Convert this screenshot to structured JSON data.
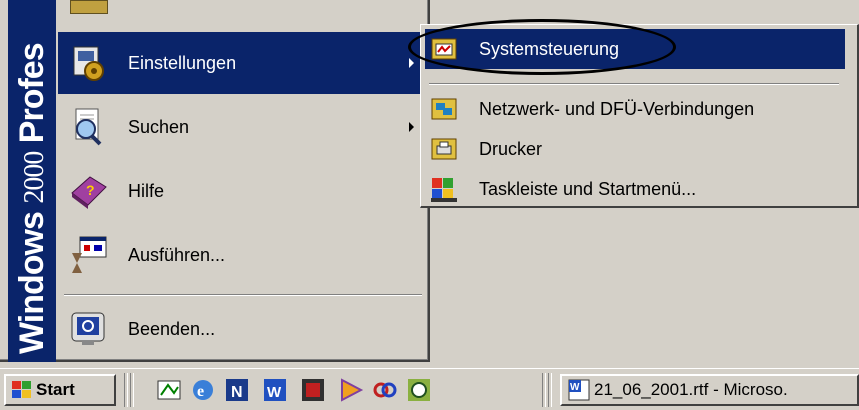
{
  "start_menu": {
    "banner_brand": "Windows",
    "banner_version": "2000",
    "banner_edition": "Profes",
    "items": [
      {
        "label": "Einstellungen",
        "icon": "settings-icon",
        "has_submenu": true,
        "selected": true
      },
      {
        "label": "Suchen",
        "icon": "search-icon",
        "has_submenu": true
      },
      {
        "label": "Hilfe",
        "icon": "help-book-icon",
        "has_submenu": false
      },
      {
        "label": "Ausführen...",
        "icon": "run-icon",
        "has_submenu": false
      },
      {
        "label": "Beenden...",
        "icon": "shutdown-icon",
        "has_submenu": false
      }
    ]
  },
  "submenu": {
    "items": [
      {
        "label": "Systemsteuerung",
        "icon": "control-panel-icon",
        "selected": true
      },
      {
        "label": "Netzwerk- und DFÜ-Verbindungen",
        "icon": "network-connections-icon"
      },
      {
        "label": "Drucker",
        "icon": "printers-icon"
      },
      {
        "label": "Taskleiste und Startmenü...",
        "icon": "taskbar-startmenu-icon"
      }
    ]
  },
  "taskbar": {
    "start_label": "Start",
    "quick_launch": [
      "show-desktop-icon",
      "internet-explorer-icon",
      "n-app-icon",
      "word-icon",
      "app-icon",
      "media-player-icon",
      "link-icon",
      "clock-app-icon"
    ],
    "task_button_label": "21_06_2001.rtf - Microso."
  },
  "colors": {
    "selection": "#0a246a",
    "face": "#d4d0c8"
  }
}
